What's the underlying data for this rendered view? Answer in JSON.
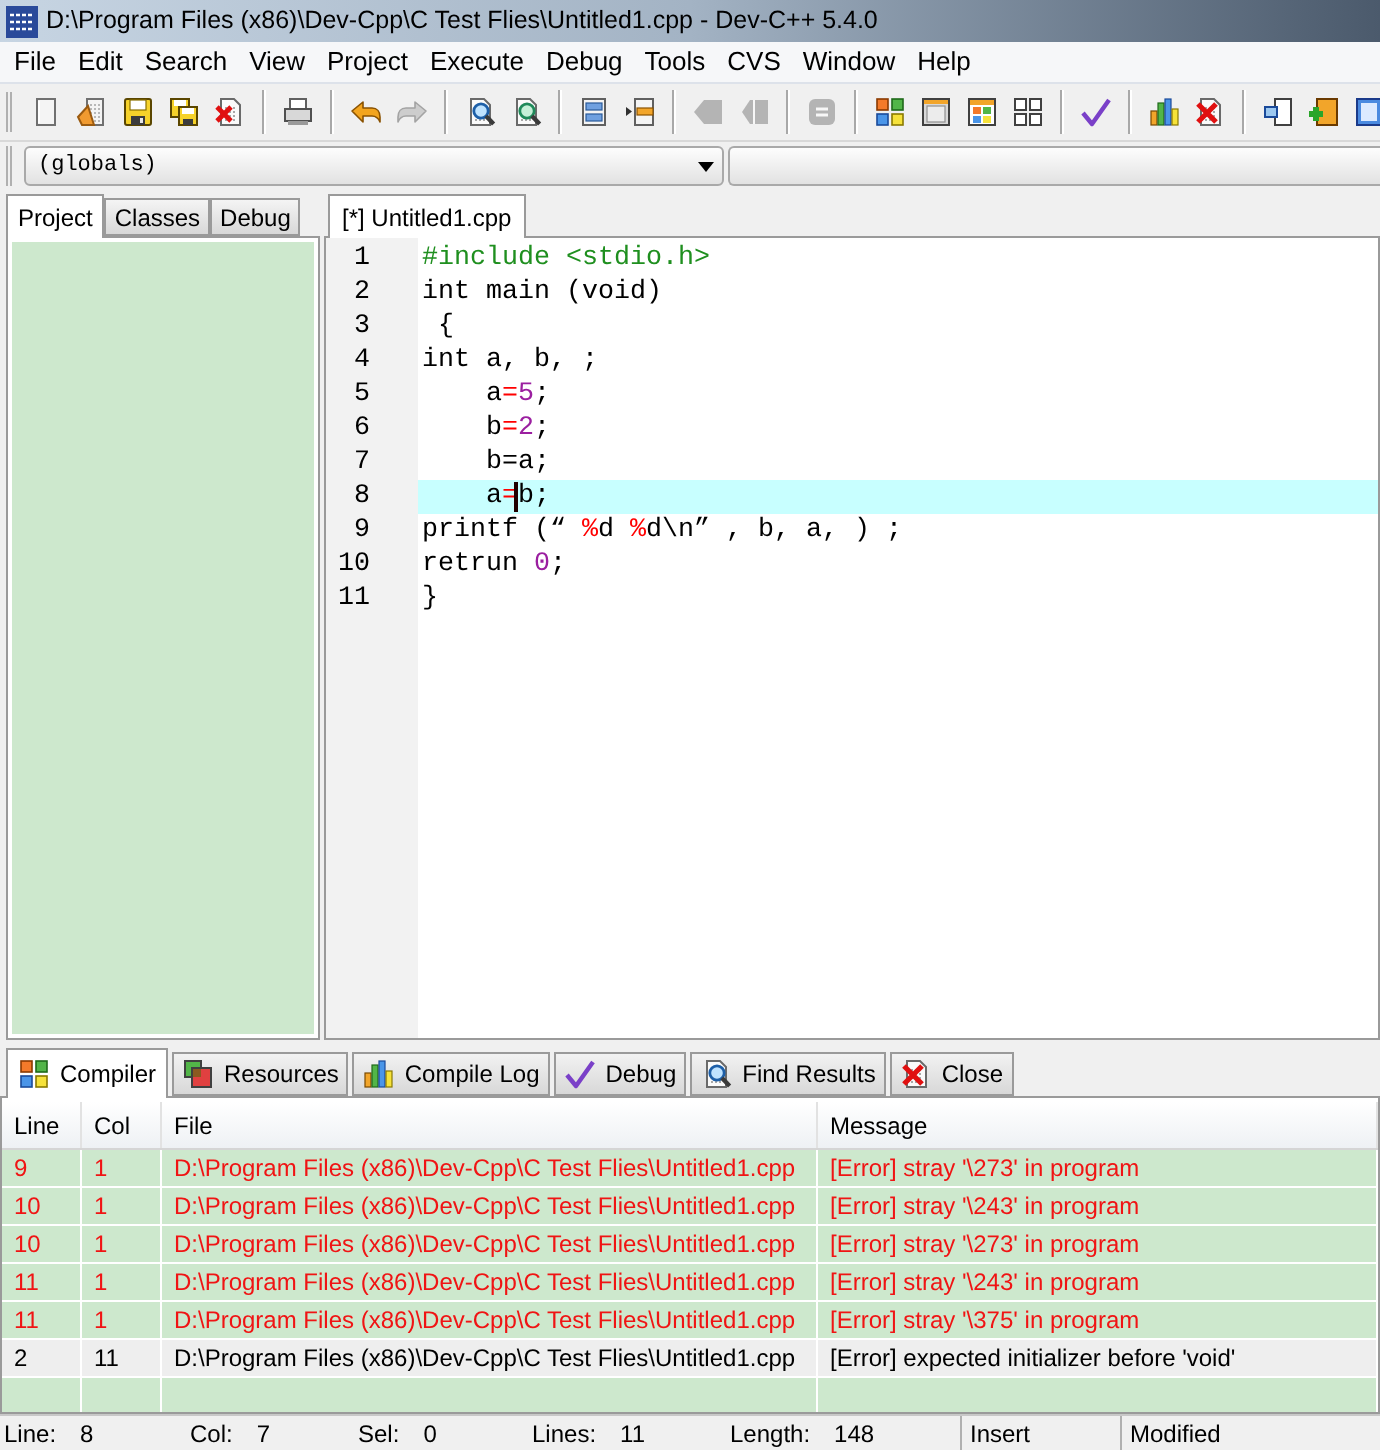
{
  "window": {
    "title": "D:\\Program Files (x86)\\Dev-Cpp\\C Test Flies\\Untitled1.cpp - Dev-C++ 5.4.0"
  },
  "menu": [
    "File",
    "Edit",
    "Search",
    "View",
    "Project",
    "Execute",
    "Debug",
    "Tools",
    "CVS",
    "Window",
    "Help"
  ],
  "toolbar": [
    [
      {
        "kind": "new",
        "disabled": false
      },
      {
        "kind": "open",
        "disabled": false
      },
      {
        "kind": "save",
        "disabled": false
      },
      {
        "kind": "save_all",
        "disabled": false
      },
      {
        "kind": "close",
        "disabled": false
      }
    ],
    [
      {
        "kind": "print",
        "disabled": false
      }
    ],
    [
      {
        "kind": "undo",
        "disabled": false
      },
      {
        "kind": "redo",
        "disabled": true
      }
    ],
    [
      {
        "kind": "find",
        "disabled": false
      },
      {
        "kind": "replace",
        "disabled": false
      }
    ],
    [
      {
        "kind": "indent",
        "disabled": false
      },
      {
        "kind": "unindent",
        "disabled": false
      }
    ],
    [
      {
        "kind": "bookmark_prev",
        "disabled": true
      },
      {
        "kind": "bookmark_next",
        "disabled": true
      }
    ],
    [
      {
        "kind": "goto",
        "disabled": true
      }
    ],
    [
      {
        "kind": "compile",
        "disabled": false
      },
      {
        "kind": "run",
        "disabled": false
      },
      {
        "kind": "compile_run",
        "disabled": false
      },
      {
        "kind": "rebuild",
        "disabled": false
      }
    ],
    [
      {
        "kind": "syntax_check",
        "disabled": false
      }
    ],
    [
      {
        "kind": "profile",
        "disabled": false
      },
      {
        "kind": "delete_profile",
        "disabled": false
      }
    ],
    [
      {
        "kind": "new_project",
        "disabled": false
      },
      {
        "kind": "add_file",
        "disabled": false
      },
      {
        "kind": "remove_file",
        "disabled": false
      }
    ]
  ],
  "scope_combo": {
    "value": "(globals)"
  },
  "left_tabs": [
    {
      "label": "Project",
      "selected": true
    },
    {
      "label": "Classes",
      "selected": false
    },
    {
      "label": "Debug",
      "selected": false
    }
  ],
  "editor_tabs": [
    {
      "label": "[*] Untitled1.cpp",
      "selected": true
    }
  ],
  "editor": {
    "lines": [
      {
        "number": "1",
        "current": false,
        "tokens": [
          {
            "kind": "preprocessor",
            "text": "#include <stdio.h>"
          }
        ]
      },
      {
        "number": "2",
        "current": false,
        "tokens": [
          {
            "kind": "plain",
            "text": "int main (void)"
          }
        ]
      },
      {
        "number": "3",
        "current": false,
        "tokens": [
          {
            "kind": "plain",
            "text": " {"
          }
        ]
      },
      {
        "number": "4",
        "current": false,
        "tokens": [
          {
            "kind": "plain",
            "text": "int a, b, ;"
          }
        ]
      },
      {
        "number": "5",
        "current": false,
        "tokens": [
          {
            "kind": "plain",
            "text": "    a"
          },
          {
            "kind": "operator",
            "text": "="
          },
          {
            "kind": "number",
            "text": "5"
          },
          {
            "kind": "plain",
            "text": ";"
          }
        ]
      },
      {
        "number": "6",
        "current": false,
        "tokens": [
          {
            "kind": "plain",
            "text": "    b"
          },
          {
            "kind": "operator",
            "text": "="
          },
          {
            "kind": "number",
            "text": "2"
          },
          {
            "kind": "plain",
            "text": ";"
          }
        ]
      },
      {
        "number": "7",
        "current": false,
        "tokens": [
          {
            "kind": "plain",
            "text": "    b=a;"
          }
        ]
      },
      {
        "number": "8",
        "current": true,
        "tokens": [
          {
            "kind": "plain",
            "text": "    a"
          },
          {
            "kind": "operator",
            "text": "="
          },
          {
            "kind": "caret"
          },
          {
            "kind": "plain",
            "text": "b;"
          }
        ]
      },
      {
        "number": "9",
        "current": false,
        "tokens": [
          {
            "kind": "plain",
            "text": "printf (“ "
          },
          {
            "kind": "operator",
            "text": "%"
          },
          {
            "kind": "plain",
            "text": "d "
          },
          {
            "kind": "operator",
            "text": "%"
          },
          {
            "kind": "plain",
            "text": "d\\n” , b, a, ) ;"
          }
        ]
      },
      {
        "number": "10",
        "current": false,
        "tokens": [
          {
            "kind": "plain",
            "text": "retrun "
          },
          {
            "kind": "number",
            "text": "0"
          },
          {
            "kind": "plain",
            "text": ";"
          }
        ]
      },
      {
        "number": "11",
        "current": false,
        "tokens": [
          {
            "kind": "plain",
            "text": "}"
          }
        ]
      }
    ]
  },
  "bottom_tabs": [
    {
      "kind": "compiler",
      "label": "Compiler",
      "selected": true
    },
    {
      "kind": "resources",
      "label": "Resources",
      "selected": false
    },
    {
      "kind": "compile_log",
      "label": "Compile Log",
      "selected": false
    },
    {
      "kind": "debug",
      "label": "Debug",
      "selected": false
    },
    {
      "kind": "find_results",
      "label": "Find Results",
      "selected": false
    },
    {
      "kind": "close",
      "label": "Close",
      "selected": false
    }
  ],
  "messages": {
    "columns": [
      "Line",
      "Col",
      "File",
      "Message"
    ],
    "rows": [
      {
        "cells": [
          "9",
          "1",
          "D:\\Program Files (x86)\\Dev-Cpp\\C Test Flies\\Untitled1.cpp",
          "[Error] stray '\\273' in program"
        ],
        "selected": false
      },
      {
        "cells": [
          "10",
          "1",
          "D:\\Program Files (x86)\\Dev-Cpp\\C Test Flies\\Untitled1.cpp",
          "[Error] stray '\\243' in program"
        ],
        "selected": false
      },
      {
        "cells": [
          "10",
          "1",
          "D:\\Program Files (x86)\\Dev-Cpp\\C Test Flies\\Untitled1.cpp",
          "[Error] stray '\\273' in program"
        ],
        "selected": false
      },
      {
        "cells": [
          "11",
          "1",
          "D:\\Program Files (x86)\\Dev-Cpp\\C Test Flies\\Untitled1.cpp",
          "[Error] stray '\\243' in program"
        ],
        "selected": false
      },
      {
        "cells": [
          "11",
          "1",
          "D:\\Program Files (x86)\\Dev-Cpp\\C Test Flies\\Untitled1.cpp",
          "[Error] stray '\\375' in program"
        ],
        "selected": false
      },
      {
        "cells": [
          "2",
          "11",
          "D:\\Program Files (x86)\\Dev-Cpp\\C Test Flies\\Untitled1.cpp",
          "[Error] expected initializer before 'void'"
        ],
        "selected": true
      }
    ]
  },
  "status_bar": {
    "fields": [
      {
        "label": "Line:",
        "value": "8"
      },
      {
        "label": "Col:",
        "value": "7"
      },
      {
        "label": "Sel:",
        "value": "0"
      },
      {
        "label": "Lines:",
        "value": "11"
      },
      {
        "label": "Length:",
        "value": "148"
      }
    ],
    "mode": "Insert",
    "state": "Modified"
  }
}
